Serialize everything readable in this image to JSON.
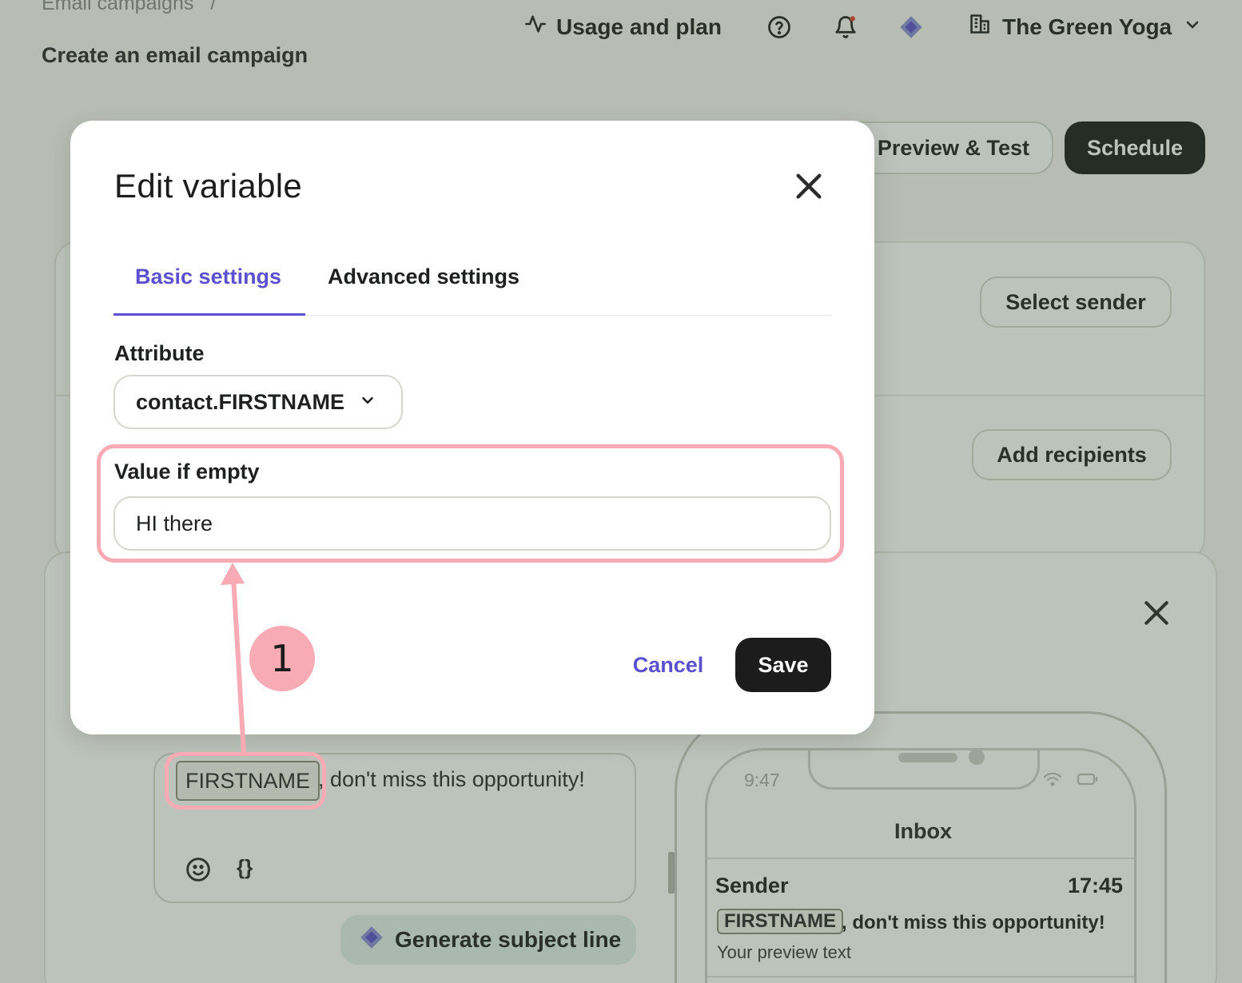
{
  "breadcrumb": {
    "parent": "Email campaigns",
    "separator": "/"
  },
  "page": {
    "title": "Create an email campaign"
  },
  "topnav": {
    "usage_label": "Usage and plan",
    "organization": "The Green Yoga"
  },
  "actions": {
    "preview_label": "Preview & Test",
    "schedule_label": "Schedule"
  },
  "setup": {
    "sender_button": "Select sender",
    "recipients_button": "Add recipients"
  },
  "subject": {
    "variable_chip": "FIRSTNAME",
    "text_after": ", don't miss this opportunity!",
    "braces": "{}",
    "generate_label": "Generate subject line"
  },
  "phone_preview": {
    "time": "9:47",
    "inbox_title": "Inbox",
    "sender": "Sender",
    "received_time": "17:45",
    "variable_chip": "FIRSTNAME",
    "subject_rest": ", don't miss this opportunity!",
    "preview_text": "Your preview text"
  },
  "modal": {
    "title": "Edit variable",
    "tabs": [
      {
        "label": "Basic settings",
        "active": true
      },
      {
        "label": "Advanced settings",
        "active": false
      }
    ],
    "attribute_label": "Attribute",
    "attribute_value": "contact.FIRSTNAME",
    "empty_label": "Value if empty",
    "empty_value": "HI there",
    "cancel_label": "Cancel",
    "save_label": "Save"
  },
  "annotation": {
    "step_number": "1",
    "color": "#f8aab5"
  },
  "colors": {
    "accent": "#5b50cf",
    "dark_button": "#1b1c1b"
  }
}
